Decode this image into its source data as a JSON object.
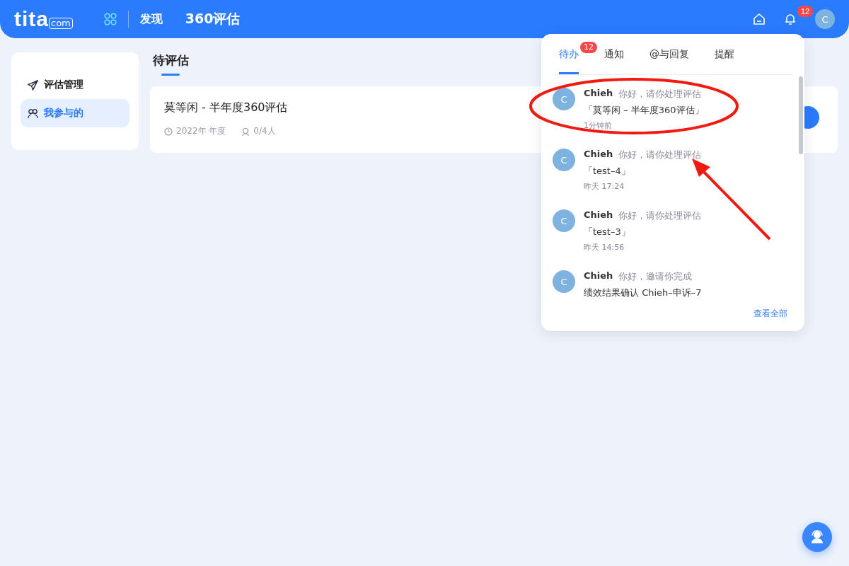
{
  "header": {
    "logo": {
      "main": "tita",
      "suffix": "com"
    },
    "nav": [
      {
        "label": "发现",
        "selected": false
      },
      {
        "label": "360评估",
        "selected": true
      }
    ],
    "notification_count": "12",
    "avatar": "C"
  },
  "sidebar": {
    "items": [
      {
        "label": "评估管理",
        "kind": "send",
        "selected": false
      },
      {
        "label": "我参与的",
        "kind": "people",
        "selected": true
      }
    ]
  },
  "main": {
    "title": "待评估",
    "cards": [
      {
        "title": "莫等闲 - 半年度360评估",
        "period": "2022年 年度",
        "participants": "0/4人"
      }
    ]
  },
  "popup": {
    "tabs": [
      {
        "label": "待办",
        "badge": "12",
        "selected": true
      },
      {
        "label": "通知",
        "selected": false
      },
      {
        "label": "@与回复",
        "selected": false
      },
      {
        "label": "提醒",
        "selected": false
      }
    ],
    "items": [
      {
        "avatar": "C",
        "name": "Chieh",
        "action": "你好，请你处理评估",
        "subject": "「莫等闲 – 半年度360评估」",
        "time": "1分钟前"
      },
      {
        "avatar": "C",
        "name": "Chieh",
        "action": "你好，请你处理评估",
        "subject": "「test–4」",
        "time": "昨天 17:24"
      },
      {
        "avatar": "C",
        "name": "Chieh",
        "action": "你好，请你处理评估",
        "subject": "「test–3」",
        "time": "昨天 14:56"
      },
      {
        "avatar": "C",
        "name": "Chieh",
        "action": "你好，邀请你完成",
        "subject": "绩效结果确认 Chieh–申诉–7"
      }
    ],
    "footer_link": "查看全部"
  }
}
